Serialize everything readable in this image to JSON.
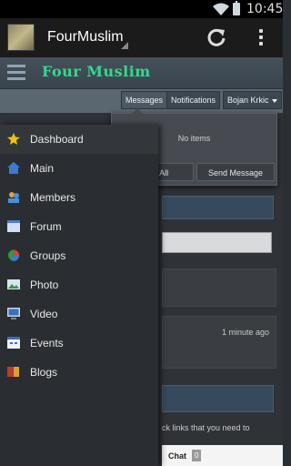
{
  "statusbar": {
    "time": "10:45"
  },
  "actionbar": {
    "title": "FourMuslim"
  },
  "site": {
    "logo": "Four Muslim",
    "tabs": {
      "messages": "Messages",
      "notifications": "Notifications",
      "user": "Bojan Krkic"
    }
  },
  "messages_dropdown": {
    "empty": "No items",
    "view_all": "View All",
    "send_message": "Send Message"
  },
  "drawer": {
    "items": [
      {
        "label": "Dashboard",
        "icon": "star-icon"
      },
      {
        "label": "Main",
        "icon": "home-icon"
      },
      {
        "label": "Members",
        "icon": "members-icon"
      },
      {
        "label": "Forum",
        "icon": "forum-icon"
      },
      {
        "label": "Groups",
        "icon": "groups-icon"
      },
      {
        "label": "Photo",
        "icon": "photo-icon"
      },
      {
        "label": "Video",
        "icon": "video-icon"
      },
      {
        "label": "Events",
        "icon": "calendar-icon"
      },
      {
        "label": "Blogs",
        "icon": "blogs-icon"
      }
    ]
  },
  "background": {
    "timestamp": "1 minute ago",
    "partial_text": "ck links that you need to",
    "chat_label": "Chat",
    "chat_count": "0"
  },
  "colors": {
    "logo": "#34d890",
    "actionbar": "#1b1b1b",
    "drawer": "#2a2d31"
  }
}
